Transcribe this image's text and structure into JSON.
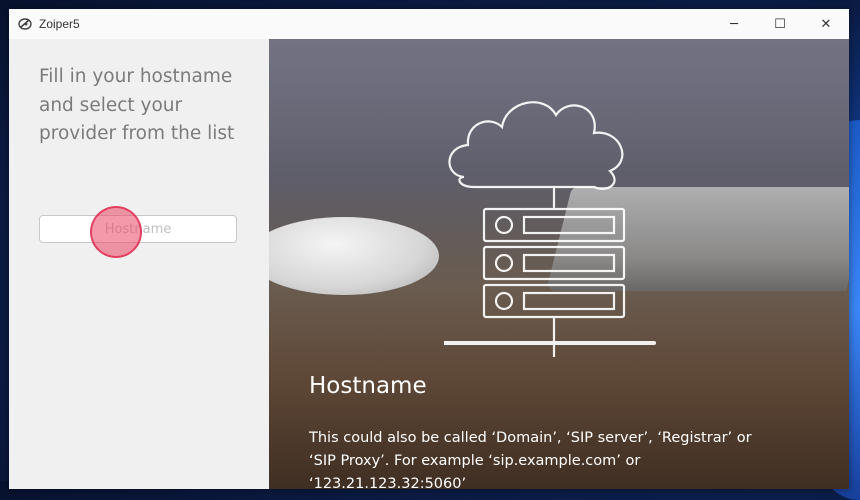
{
  "window": {
    "title": "Zoiper5",
    "controls": {
      "minimize": "─",
      "maximize": "☐",
      "close": "✕"
    }
  },
  "left_panel": {
    "instructions": " Fill in your hostname\nand select your\nprovider from the list",
    "hostname_input": {
      "value": "",
      "placeholder": "Hostname"
    }
  },
  "right_panel": {
    "title": "Hostname",
    "body": " This could also be called ‘Domain’, ‘SIP server’, ‘Registrar’ or ‘SIP Proxy’. For example ‘sip.example.com’ or ‘123.21.123.32:5060’"
  },
  "icons": [
    "zoiper-app-icon",
    "cloud-server-illustration"
  ],
  "colors": {
    "click_indicator": "#e8466a",
    "instruction_text": "#7b7b7b",
    "info_text": "#ffffff"
  }
}
